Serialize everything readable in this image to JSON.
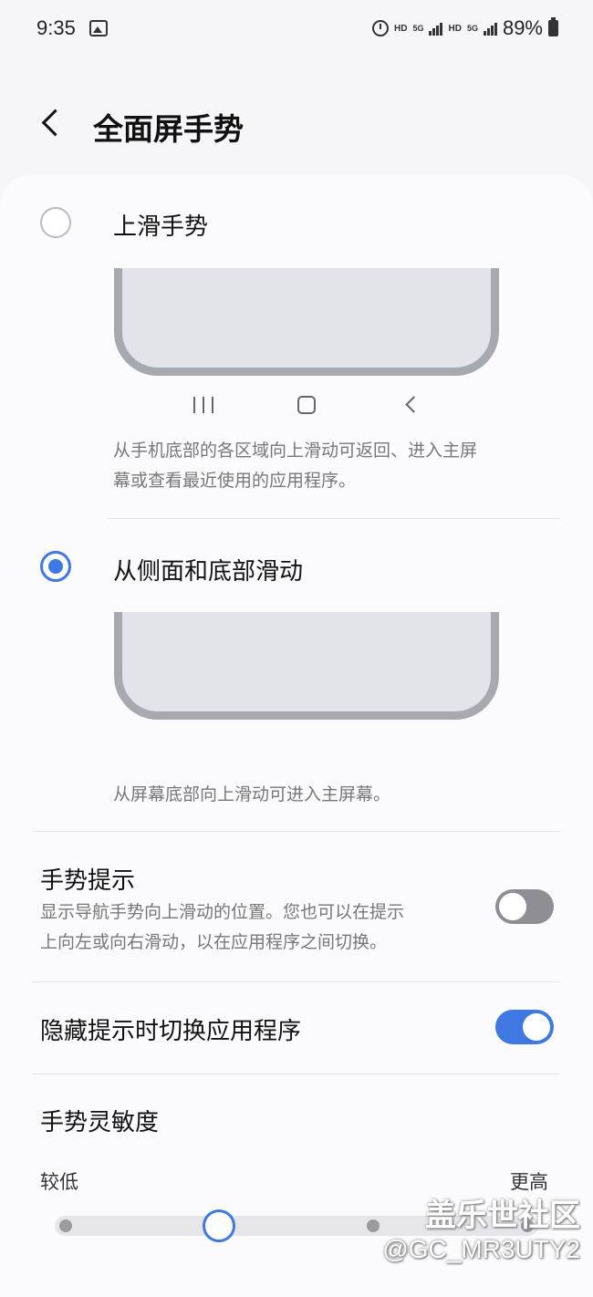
{
  "status_bar": {
    "time": "9:35",
    "hd1": "HD",
    "fiveg1": "5G",
    "hd2": "HD",
    "fiveg2": "5G",
    "battery": "89%"
  },
  "header": {
    "title": "全面屏手势"
  },
  "options": [
    {
      "label": "上滑手势",
      "selected": false,
      "description_lines": [
        "从手机底部的各区域向上滑动可返回、进入主屏",
        "幕或查看最近使用的应用程序。"
      ]
    },
    {
      "label": "从侧面和底部滑动",
      "selected": true,
      "description_lines": [
        "从屏幕底部向上滑动可进入主屏幕。"
      ]
    }
  ],
  "gesture_hint": {
    "title": "手势提示",
    "description_lines": [
      "显示导航手势向上滑动的位置。您也可以在提示",
      "上向左或向右滑动，以在应用程序之间切换。"
    ],
    "enabled": false
  },
  "hide_hint_switch": {
    "title": "隐藏提示时切换应用程序",
    "enabled": true
  },
  "sensitivity": {
    "title": "手势灵敏度",
    "low_label": "较低",
    "high_label": "更高",
    "level": 2,
    "levels": 4
  },
  "watermark": {
    "line1": "盖乐世社区",
    "line2": "@GC_MR3UTY2"
  },
  "colors": {
    "accent": "#3e78e0",
    "background": "#f6f6f8",
    "card": "#fbfbfd"
  }
}
